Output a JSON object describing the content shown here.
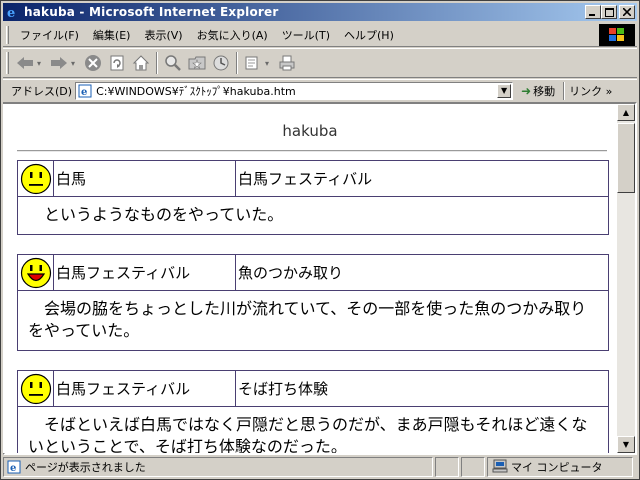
{
  "window": {
    "title": "hakuba - Microsoft Internet Explorer",
    "buttons": {
      "minimize": "_",
      "maximize": "□",
      "close": "×"
    }
  },
  "menu": [
    "ファイル(F)",
    "編集(E)",
    "表示(V)",
    "お気に入り(A)",
    "ツール(T)",
    "ヘルプ(H)"
  ],
  "toolbar": {
    "icons": [
      "back-arrow-icon",
      "forward-arrow-icon",
      "stop-icon",
      "refresh-icon",
      "home-icon",
      "search-icon",
      "favorites-icon",
      "history-icon",
      "mail-icon",
      "print-icon"
    ]
  },
  "address": {
    "label": "アドレス(D)",
    "value": "C:¥WINDOWS¥ﾃﾞｽｸﾄｯﾌﾟ¥hakuba.htm",
    "go_label": "移動",
    "links_label": "リンク »"
  },
  "page": {
    "title": "hakuba",
    "entries": [
      {
        "face": "neutral",
        "col1": "白馬",
        "col2": "白馬フェスティバル",
        "body": "というようなものをやっていた。"
      },
      {
        "face": "happy",
        "col1": "白馬フェスティバル",
        "col2": "魚のつかみ取り",
        "body": "会場の脇をちょっとした川が流れていて、その一部を使った魚のつかみ取りをやっていた。"
      },
      {
        "face": "neutral",
        "col1": "白馬フェスティバル",
        "col2": "そば打ち体験",
        "body": "そばといえば白馬ではなく戸隠だと思うのだが、まあ戸隠もそれほど遠くないということで、そば打ち体験なのだった。"
      }
    ]
  },
  "status": {
    "message": "ページが表示されました",
    "zone": "マイ コンピュータ"
  },
  "colors": {
    "title_bar_start": "#0a246a",
    "title_bar_end": "#a6caf0",
    "table_border": "#4a3f72",
    "face_fill": "#ffff00"
  }
}
